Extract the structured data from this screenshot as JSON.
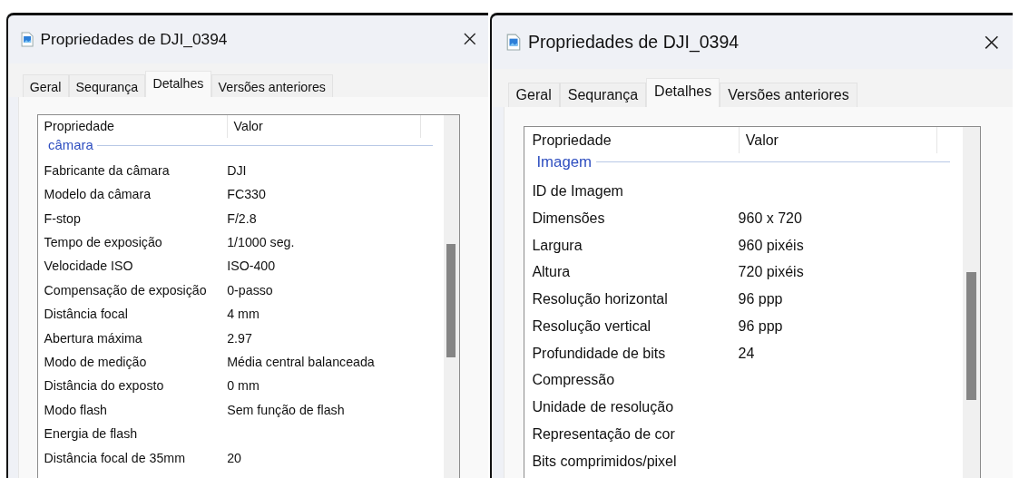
{
  "windows": [
    {
      "title": "Propriedades de DJI_0394",
      "tabs": [
        {
          "label": "Geral",
          "selected": false
        },
        {
          "label": "Sequrança",
          "selected": false
        },
        {
          "label": "Detalhes",
          "selected": true
        },
        {
          "label": "Versões anteriores",
          "selected": false
        }
      ],
      "columns": [
        "Propriedade",
        "Valor"
      ],
      "category": "câmara",
      "rows": [
        {
          "property": "Fabricante da câmara",
          "value": "DJI"
        },
        {
          "property": "Modelo da câmara",
          "value": "FC330"
        },
        {
          "property": "F-stop",
          "value": "F/2.8"
        },
        {
          "property": "Tempo de exposição",
          "value": "1/1000 seg."
        },
        {
          "property": "Velocidade ISO",
          "value": "ISO-400"
        },
        {
          "property": "Compensação de exposição",
          "value": "0-passo"
        },
        {
          "property": "Distância focal",
          "value": "4 mm"
        },
        {
          "property": "Abertura máxima",
          "value": "2.97"
        },
        {
          "property": "Modo de medição",
          "value": "Média central balanceada"
        },
        {
          "property": "Distância do exposto",
          "value": "0 mm"
        },
        {
          "property": "Modo flash",
          "value": "Sem função de flash"
        },
        {
          "property": "Energia de flash"
        },
        {
          "property": "Distância focal de 35mm",
          "value": "20"
        }
      ]
    },
    {
      "title": "Propriedades de DJI_0394",
      "tabs": [
        {
          "label": "Geral",
          "selected": false
        },
        {
          "label": "Sequrança",
          "selected": false
        },
        {
          "label": "Detalhes",
          "selected": true
        },
        {
          "label": "Versões anteriores",
          "selected": false
        }
      ],
      "columns": [
        "Propriedade",
        "Valor"
      ],
      "category": "Imagem",
      "rows": [
        {
          "property": "ID de Imagem"
        },
        {
          "property": "Dimensões",
          "value": "960 x 720"
        },
        {
          "property": "Largura",
          "value": "960 pixéis"
        },
        {
          "property": "Altura",
          "value": "720 pixéis"
        },
        {
          "property": "Resolução horizontal",
          "value": "96 ppp"
        },
        {
          "property": "Resolução vertical",
          "value": "96 ppp"
        },
        {
          "property": "Profundidade de bits",
          "value": "24"
        },
        {
          "property": "Compressão"
        },
        {
          "property": "Unidade de resolução"
        },
        {
          "property": "Representação de cor"
        },
        {
          "property": "Bits comprimidos/pixel"
        }
      ]
    }
  ]
}
